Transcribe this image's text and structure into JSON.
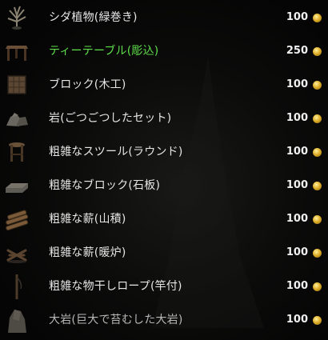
{
  "items": [
    {
      "name": "シダ植物(緑巻き)",
      "price": "100",
      "icon": "fern-plant-icon",
      "style": "normal"
    },
    {
      "name": "ティーテーブル(彫込)",
      "price": "250",
      "icon": "tea-table-icon",
      "style": "green"
    },
    {
      "name": "ブロック(木工)",
      "price": "100",
      "icon": "wooden-block-icon",
      "style": "normal"
    },
    {
      "name": "岩(ごつごつしたセット)",
      "price": "100",
      "icon": "rock-set-icon",
      "style": "normal"
    },
    {
      "name": "粗雑なスツール(ラウンド)",
      "price": "100",
      "icon": "round-stool-icon",
      "style": "normal"
    },
    {
      "name": "粗雑なブロック(石板)",
      "price": "100",
      "icon": "stone-slab-icon",
      "style": "normal"
    },
    {
      "name": "粗雑な薪(山積)",
      "price": "100",
      "icon": "firewood-pile-icon",
      "style": "normal"
    },
    {
      "name": "粗雑な薪(暖炉)",
      "price": "100",
      "icon": "fireplace-wood-icon",
      "style": "normal"
    },
    {
      "name": "粗雑な物干しロープ(竿付)",
      "price": "100",
      "icon": "clothesline-icon",
      "style": "normal"
    },
    {
      "name": "大岩(巨大で苔むした大岩)",
      "price": "100",
      "icon": "boulder-icon",
      "style": "dim"
    }
  ],
  "currency_icon": "gold-coin-icon",
  "colors": {
    "highlight": "#5ee04a",
    "text": "#e6e6e6",
    "coin": "#e0b02a"
  }
}
